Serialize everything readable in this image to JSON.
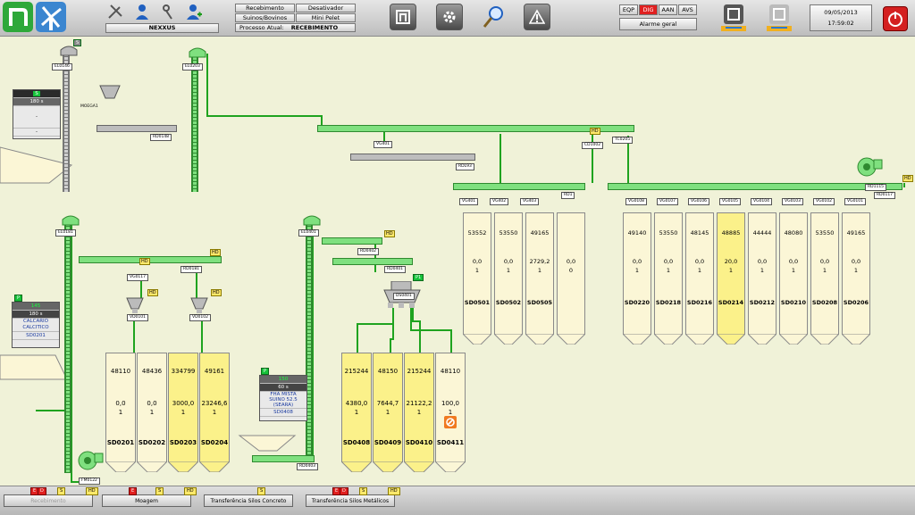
{
  "header": {
    "system_name": "NEXXUS",
    "buttons": [
      "Recebimento",
      "Desativador",
      "Suinos/Bovinos",
      "Mini Pelet"
    ],
    "process_label": "Processo Atual:",
    "process_value": "RECEBIMENTO",
    "modes": [
      "EQP",
      "DIG",
      "AAN",
      "AVS"
    ],
    "active_mode": "DIG",
    "alarm": "Alarme geral",
    "date": "09/05/2013",
    "time": "17:59:02",
    "accent": "#e02020"
  },
  "equipment": {
    "EL0146": "EL0146",
    "EL0203": "EL0203",
    "MOEGA1": "MOEGA1",
    "RD0148": "RD0148",
    "VG401": "VG401",
    "RDL93": "RDL93",
    "CD1002": "CD1002",
    "TC0205": "TC0205",
    "RD0402": "RD0402",
    "RD1": "RD1",
    "EL0181": "EL0181",
    "RD0181": "RD0181",
    "VG0117": "VG0117",
    "VD0101": "VD0101",
    "VD0102": "VD0102",
    "FM0122": "FM0122",
    "EL0401": "EL0401",
    "RD0401": "RD0401",
    "RD0402b": "RD0402",
    "DS0401": "DS0401",
    "RD0403": "RD0403",
    "RD1115": "RD1115",
    "RD0117": "RD0117"
  },
  "valves_a": [
    "VG401",
    "VG402",
    "VG403"
  ],
  "valves_b": [
    "VG0108",
    "VG0107",
    "VG0106",
    "VG0105",
    "VG0104",
    "VG0103",
    "VG0102",
    "VG0101"
  ],
  "panel_top": {
    "badge": "S",
    "value": "180 s",
    "l1": "-",
    "l2": "-"
  },
  "panel_mid": {
    "badge": "P",
    "count": "145",
    "value": "180 s",
    "name1": "CALCARIO",
    "name2": "CALCITICO",
    "silo": "SD0201"
  },
  "panel_low": {
    "badge": "P",
    "count": "150",
    "value": "60 s",
    "name1": "FHA MISTA",
    "name2": "SUINO 52.5",
    "name3": "(SEARA)",
    "silo": "SD0408"
  },
  "badges": {
    "hd": "HD",
    "p1": "P1",
    "s": "S"
  },
  "silos_top": [
    {
      "v1": "53552",
      "v2": "0,0",
      "v3": "1",
      "id": "SD0501",
      "y": false
    },
    {
      "v1": "53550",
      "v2": "0,0",
      "v3": "1",
      "id": "SD0502",
      "y": false
    },
    {
      "v1": "49165",
      "v2": "2729,2",
      "v3": "1",
      "id": "SD0505",
      "y": false
    },
    {
      "v1": "",
      "v2": "0,0",
      "v3": "0",
      "id": "",
      "y": false
    }
  ],
  "silos_right": [
    {
      "v1": "49140",
      "v2": "0,0",
      "v3": "1",
      "id": "SD0220",
      "y": false
    },
    {
      "v1": "53550",
      "v2": "0,0",
      "v3": "1",
      "id": "SD0218",
      "y": false
    },
    {
      "v1": "48145",
      "v2": "0,0",
      "v3": "1",
      "id": "SD0216",
      "y": false
    },
    {
      "v1": "48885",
      "v2": "20,0",
      "v3": "1",
      "id": "SD0214",
      "y": true
    },
    {
      "v1": "44444",
      "v2": "0,0",
      "v3": "1",
      "id": "SD0212",
      "y": false
    },
    {
      "v1": "48080",
      "v2": "0,0",
      "v3": "1",
      "id": "SD0210",
      "y": false
    },
    {
      "v1": "53550",
      "v2": "0,0",
      "v3": "1",
      "id": "SD0208",
      "y": false
    },
    {
      "v1": "49165",
      "v2": "0,0",
      "v3": "1",
      "id": "SD0206",
      "y": false
    }
  ],
  "silos_left": [
    {
      "v1": "48110",
      "v2": "0,0",
      "v3": "1",
      "id": "SD0201",
      "y": false
    },
    {
      "v1": "48436",
      "v2": "0,0",
      "v3": "1",
      "id": "SD0202",
      "y": false
    },
    {
      "v1": "334799",
      "v2": "3000,0",
      "v3": "1",
      "id": "SD0203",
      "y": true
    },
    {
      "v1": "49161",
      "v2": "23246,6",
      "v3": "1",
      "id": "SD0204",
      "y": true
    }
  ],
  "silos_mid": [
    {
      "v1": "215244",
      "v2": "4380,0",
      "v3": "1",
      "id": "SD0408",
      "y": true
    },
    {
      "v1": "48150",
      "v2": "7644,7",
      "v3": "1",
      "id": "SD0409",
      "y": true
    },
    {
      "v1": "215244",
      "v2": "21122,2",
      "v3": "1",
      "id": "SD0410",
      "y": true
    },
    {
      "v1": "48110",
      "v2": "100,0",
      "v3": "1",
      "id": "SD0411",
      "y": false
    }
  ],
  "nav": [
    {
      "label": "Recebimento",
      "flags": [
        "E",
        "D",
        "S",
        "HD"
      ]
    },
    {
      "label": "Moagem",
      "flags": [
        "E",
        "S",
        "HD"
      ]
    },
    {
      "label": "Transferência Silos Concreto",
      "flags": [
        "S"
      ]
    },
    {
      "label": "Transferência Silos Metálicos",
      "flags": [
        "E",
        "D",
        "S",
        "HD"
      ]
    }
  ]
}
